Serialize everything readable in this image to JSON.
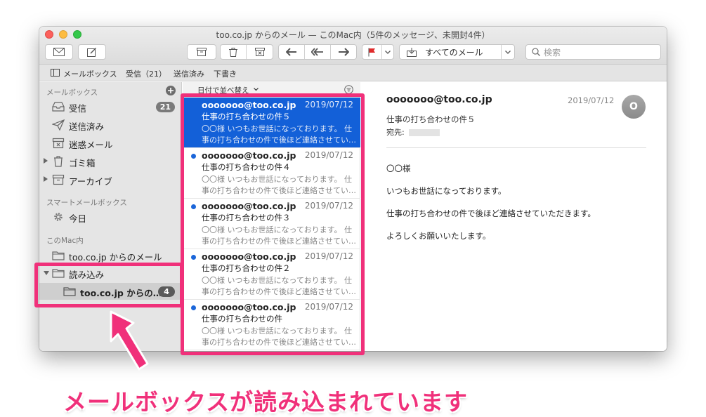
{
  "window": {
    "title": "too.co.jp からのメール — このMac内（5件のメッセージ、未開封4件）"
  },
  "toolbar": {
    "mailbox_select": "すべてのメール",
    "search_placeholder": "検索"
  },
  "favorites": [
    {
      "label": "メールボックス"
    },
    {
      "label": "受信（21）"
    },
    {
      "label": "送信済み"
    },
    {
      "label": "下書き"
    }
  ],
  "sidebar": {
    "mailboxes_header": "メールボックス",
    "items": [
      {
        "label": "受信",
        "badge": "21",
        "icon": "inbox-icon"
      },
      {
        "label": "送信済み",
        "icon": "paper-plane-icon"
      },
      {
        "label": "迷惑メール",
        "icon": "junk-icon"
      },
      {
        "label": "ゴミ箱",
        "icon": "trash-icon"
      },
      {
        "label": "アーカイブ",
        "icon": "archive-icon"
      }
    ],
    "smart_header": "スマートメールボックス",
    "smart_items": [
      {
        "label": "今日",
        "icon": "gear-icon"
      }
    ],
    "mac_header": "このMac内",
    "mac_items": [
      {
        "label": "too.co.jp からのメール"
      },
      {
        "label": "読み込み"
      },
      {
        "label": "too.co.jp からの…",
        "badge": "4"
      }
    ]
  },
  "list": {
    "sort_label": "日付で並べ替え",
    "messages": [
      {
        "from": "ooooooo@too.co.jp",
        "date": "2019/07/12",
        "subject": "仕事の打ち合わせの件５",
        "preview": "〇〇様 いつもお世話になっております。 仕事の打ち合わせの件で後ほど連絡させてい…",
        "unread": false,
        "selected": true
      },
      {
        "from": "ooooooo@too.co.jp",
        "date": "2019/07/12",
        "subject": "仕事の打ち合わせの件４",
        "preview": "〇〇様 いつもお世話になっております。 仕事の打ち合わせの件で後ほど連絡させてい…",
        "unread": true,
        "selected": false
      },
      {
        "from": "ooooooo@too.co.jp",
        "date": "2019/07/12",
        "subject": "仕事の打ち合わせの件３",
        "preview": "〇〇様 いつもお世話になっております。 仕事の打ち合わせの件で後ほど連絡させてい…",
        "unread": true,
        "selected": false
      },
      {
        "from": "ooooooo@too.co.jp",
        "date": "2019/07/12",
        "subject": "仕事の打ち合わせの件２",
        "preview": "〇〇様 いつもお世話になっております。 仕事の打ち合わせの件で後ほど連絡させてい…",
        "unread": true,
        "selected": false
      },
      {
        "from": "ooooooo@too.co.jp",
        "date": "2019/07/12",
        "subject": "仕事の打ち合わせの件",
        "preview": "〇〇様 いつもお世話になっております。 仕事の打ち合わせの件で後ほど連絡させてい…",
        "unread": true,
        "selected": false
      }
    ]
  },
  "reader": {
    "from": "ooooooo@too.co.jp",
    "date": "2019/07/12",
    "avatar": "O",
    "subject": "仕事の打ち合わせの件５",
    "to_label": "宛先:",
    "body": [
      "〇〇様",
      "いつもお世話になっております。",
      "仕事の打ち合わせの件で後ほど連絡させていただきます。",
      "よろしくお願いいたします。"
    ]
  },
  "annotation": {
    "caption": "メールボックスが読み込まれています",
    "color": "#f0307a"
  }
}
